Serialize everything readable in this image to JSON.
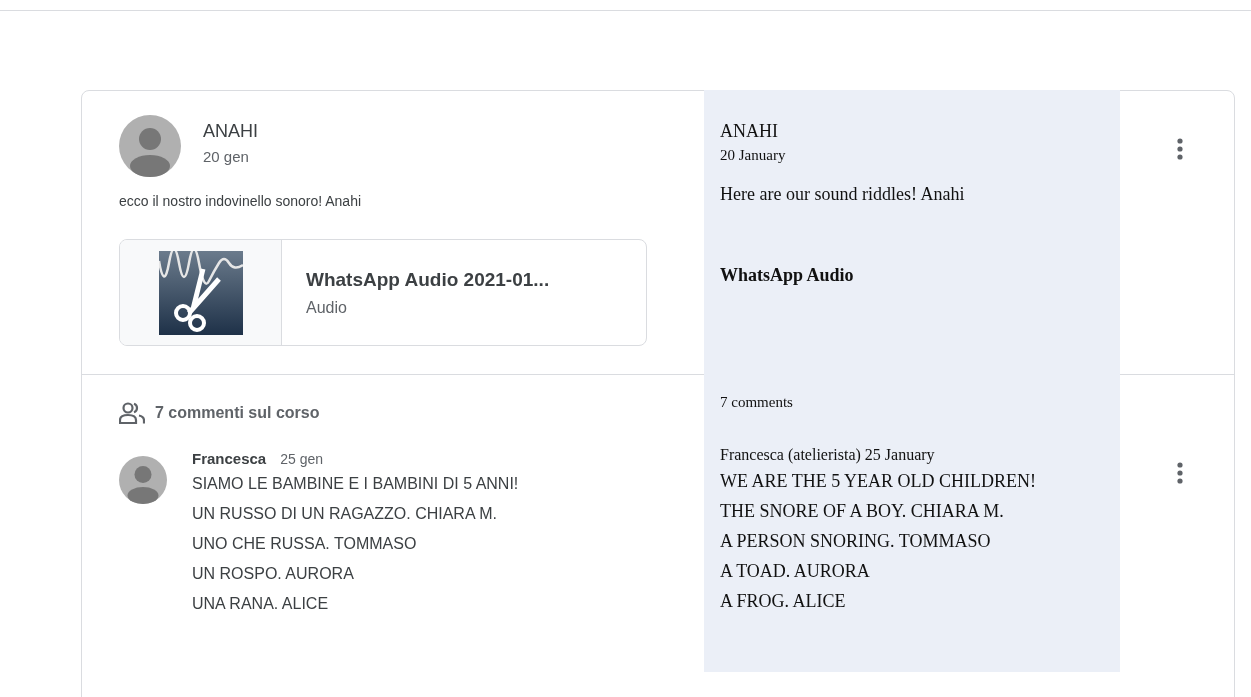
{
  "post": {
    "author": "ANAHI",
    "date": "20 gen",
    "text": "ecco il nostro indovinello sonoro! Anahi",
    "attachment": {
      "title": "WhatsApp Audio 2021-01...",
      "type": "Audio"
    }
  },
  "comments_header": "7 commenti sul corso",
  "comments": [
    {
      "author": "Francesca",
      "date": "25 gen",
      "lines": [
        "SIAMO LE BAMBINE E I BAMBINI DI 5 ANNI!",
        "UN RUSSO DI UN RAGAZZO. CHIARA M.",
        "UNO CHE RUSSA. TOMMASO",
        "UN ROSPO. AURORA",
        "UNA RANA. ALICE"
      ]
    }
  ],
  "translation": {
    "author": "ANAHI",
    "date": "20 January",
    "text": "Here are our sound riddles! Anahi",
    "attachment_title": "WhatsApp Audio",
    "comments_header": "7 comments",
    "comment": {
      "author_date": "Francesca (atelierista) 25 January",
      "lines": [
        "WE ARE THE 5 YEAR OLD CHILDREN!",
        "THE SNORE OF A BOY. CHIARA M.",
        "A PERSON SNORING. TOMMASO",
        "A TOAD. AURORA",
        "A FROG. ALICE"
      ]
    }
  }
}
